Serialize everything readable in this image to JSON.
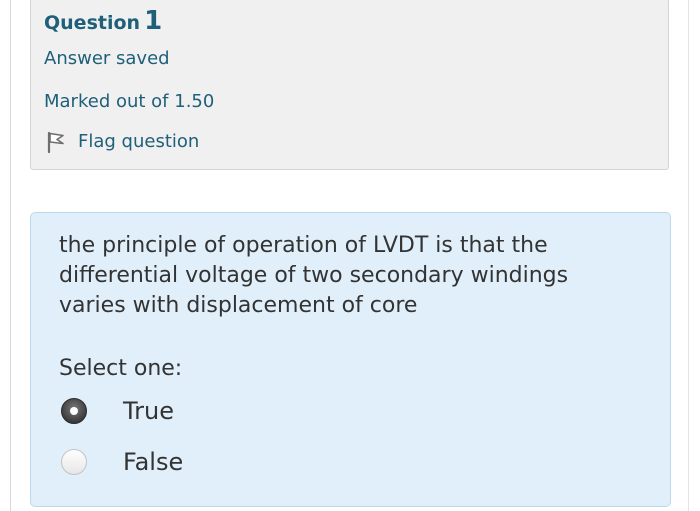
{
  "question_info": {
    "label": "Question",
    "number": "1",
    "state": "Answer saved",
    "grade": "Marked out of 1.50",
    "flag_label": "Flag question",
    "flag_icon": "flag-icon"
  },
  "question": {
    "text": "the principle of operation of LVDT is that the differential voltage of two secondary windings varies with displacement of core",
    "prompt": "Select one:",
    "options": [
      {
        "label": "True",
        "selected": true
      },
      {
        "label": "False",
        "selected": false
      }
    ]
  },
  "colors": {
    "info_text": "#1f5f7a",
    "content_bg": "#e0eff9",
    "info_bg": "#f0f0f0"
  }
}
